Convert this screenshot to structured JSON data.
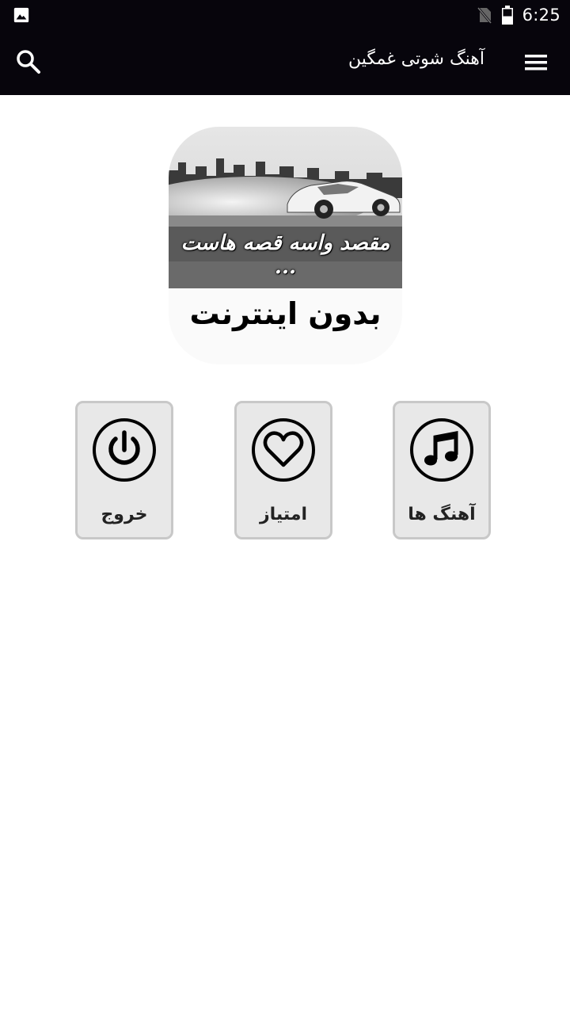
{
  "status_bar": {
    "time": "6:25",
    "icons": [
      "image-icon",
      "no-sim-icon",
      "battery-icon"
    ]
  },
  "app_bar": {
    "title": "آهنگ شوتی غمگین",
    "search_icon": "search-icon",
    "menu_icon": "menu-icon"
  },
  "banner": {
    "caption": "مقصد واسه قصه هاست ...",
    "bottom_text": "بدون اینترنت"
  },
  "tiles": [
    {
      "label": "خروج",
      "icon": "power-icon"
    },
    {
      "label": "امتیاز",
      "icon": "heart-icon"
    },
    {
      "label": "آهنگ ها",
      "icon": "music-note-icon"
    }
  ]
}
